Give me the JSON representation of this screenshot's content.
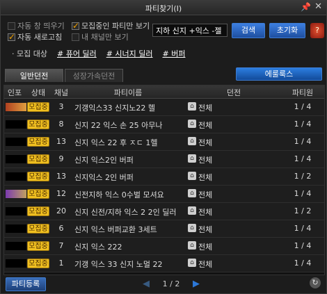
{
  "window": {
    "title": "파티찾기(I)"
  },
  "options": {
    "auto_popup": "자동 창 띄우기",
    "recruiting_only": "모집중인 파티만 보기",
    "auto_refresh": "자동 새로고침",
    "my_channel_only": "내 채널만 보기"
  },
  "search": {
    "value": "지하 신지 +익스 -젤",
    "button": "검색",
    "reset": "초기화"
  },
  "filter": {
    "label": "· 모집 대상",
    "tags": [
      "# 퓨어 딜러",
      "# 시너지 딜러",
      "# 버퍼"
    ]
  },
  "tabs": {
    "normal": "일반던전",
    "growth": "성장가속던전"
  },
  "eluluks_button": "에룰룩스",
  "table": {
    "headers": {
      "insight": "인포",
      "status": "상태",
      "channel": "채널",
      "party_name": "파티이름",
      "dungeon": "던전",
      "members": "파티원"
    },
    "rows": [
      {
        "icon": "b",
        "status": "모집중",
        "channel": "3",
        "name": "기갱익스33 신지노22 헬",
        "dungeon": "전체",
        "members": "1 / 4"
      },
      {
        "icon": "",
        "status": "모집중",
        "channel": "8",
        "name": "신지 22 익스 손 25 아무나",
        "dungeon": "전체",
        "members": "1 / 4"
      },
      {
        "icon": "",
        "status": "모집중",
        "channel": "13",
        "name": "신지 익스 22 후 ㅈㄷ 1헬",
        "dungeon": "전체",
        "members": "1 / 4"
      },
      {
        "icon": "",
        "status": "모집중",
        "channel": "9",
        "name": "신지 익스2인 버퍼",
        "dungeon": "전체",
        "members": "1 / 4"
      },
      {
        "icon": "",
        "status": "모집중",
        "channel": "13",
        "name": "신지익스 2인 버퍼",
        "dungeon": "전체",
        "members": "1 / 2"
      },
      {
        "icon": "p",
        "status": "모집중",
        "channel": "12",
        "name": "신전지하 익스 0수벌 모셔요",
        "dungeon": "전체",
        "members": "1 / 4"
      },
      {
        "icon": "",
        "status": "모집중",
        "channel": "20",
        "name": "신지 신전/지하 익스 2 2인 딜러",
        "dungeon": "전체",
        "members": "1 / 2"
      },
      {
        "icon": "",
        "status": "모집중",
        "channel": "6",
        "name": "신지 익스 버퍼교환 3세트",
        "dungeon": "전체",
        "members": "1 / 4"
      },
      {
        "icon": "",
        "status": "모집중",
        "channel": "7",
        "name": "신지 익스 222",
        "dungeon": "전체",
        "members": "1 / 4"
      },
      {
        "icon": "",
        "status": "모집중",
        "channel": "1",
        "name": "기갱 익스 33 신지 노멀 22",
        "dungeon": "전체",
        "members": "1 / 4"
      }
    ]
  },
  "register_button": "파티등록",
  "pager": {
    "text": "1 / 2"
  },
  "icons": {
    "pin": "pin-icon",
    "close": "close-icon",
    "book": "guide-book-icon",
    "lock": "dungeon-lock-icon",
    "prev": "prev-page-icon",
    "next": "next-page-icon",
    "refresh": "refresh-icon"
  }
}
